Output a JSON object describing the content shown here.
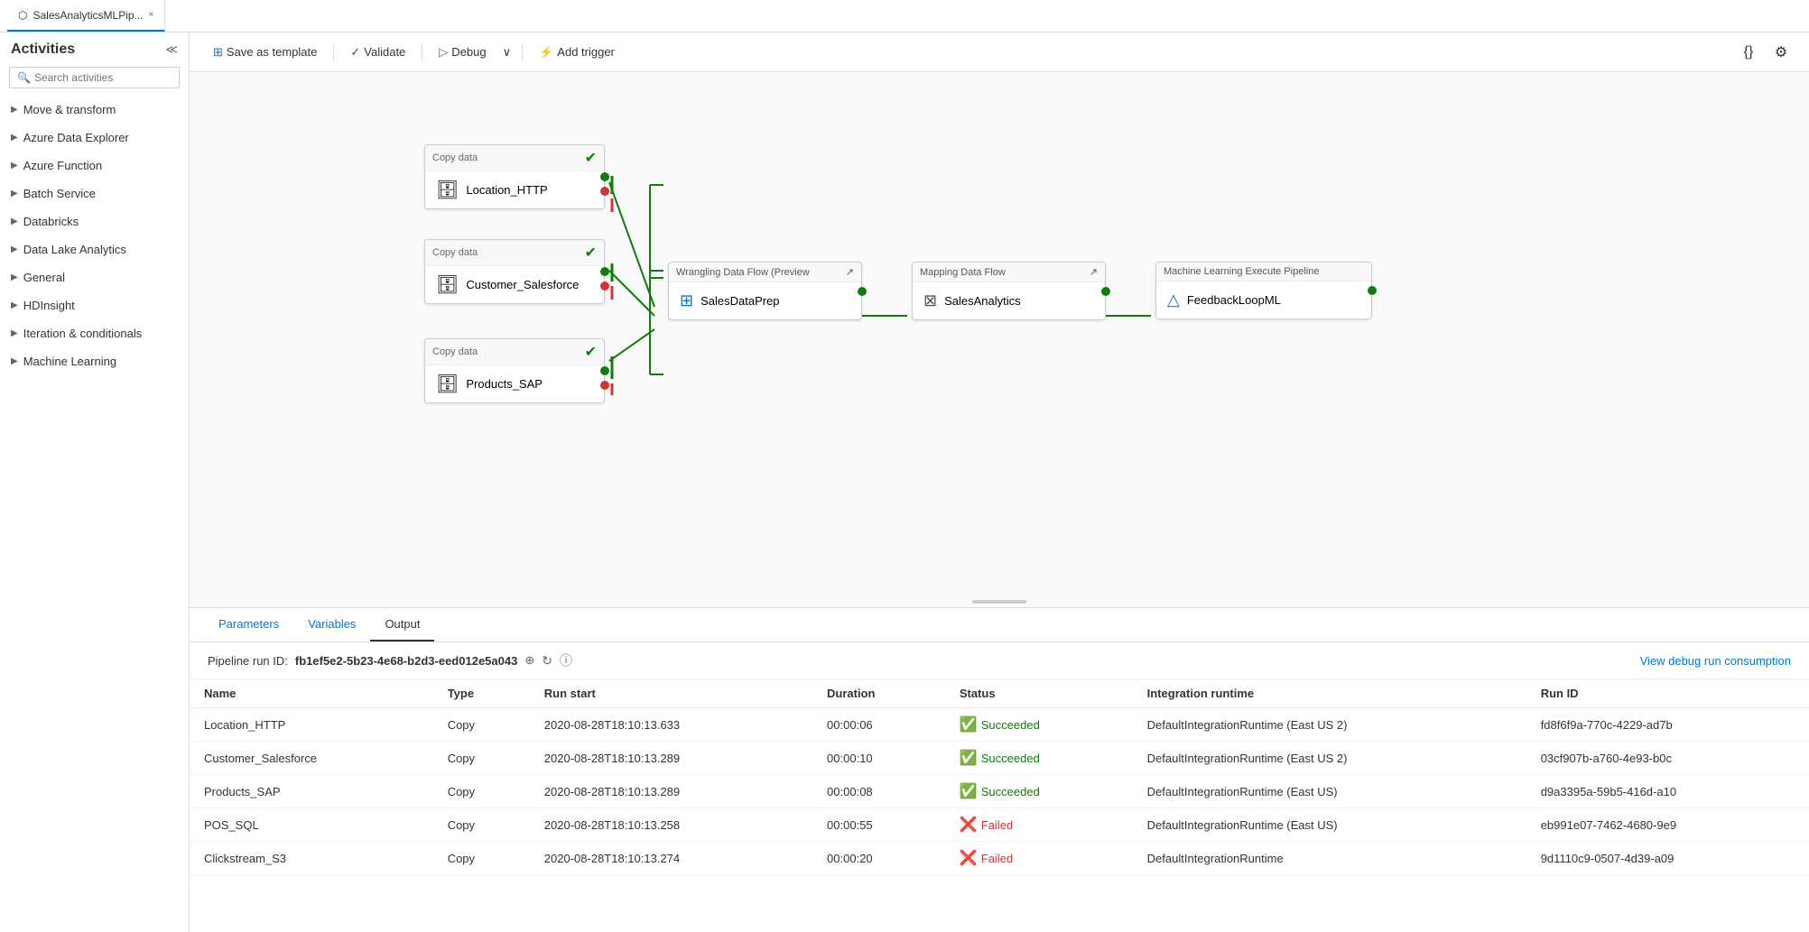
{
  "tab": {
    "title": "SalesAnalyticsMLPip...",
    "close_label": "×"
  },
  "toolbar": {
    "save_template_label": "Save as template",
    "validate_label": "Validate",
    "debug_label": "Debug",
    "add_trigger_label": "Add trigger"
  },
  "sidebar": {
    "title": "Activities",
    "search_placeholder": "Search activities",
    "items": [
      {
        "label": "Move & transform"
      },
      {
        "label": "Azure Data Explorer"
      },
      {
        "label": "Azure Function"
      },
      {
        "label": "Batch Service"
      },
      {
        "label": "Databricks"
      },
      {
        "label": "Data Lake Analytics"
      },
      {
        "label": "General"
      },
      {
        "label": "HDInsight"
      },
      {
        "label": "Iteration & conditionals"
      },
      {
        "label": "Machine Learning"
      }
    ]
  },
  "pipeline": {
    "nodes": {
      "copy1": {
        "header": "Copy data",
        "name": "Location_HTTP"
      },
      "copy2": {
        "header": "Copy data",
        "name": "Customer_Salesforce"
      },
      "copy3": {
        "header": "Copy data",
        "name": "Products_SAP"
      },
      "wrangling": {
        "header": "Wrangling Data Flow (Preview ↗",
        "name": "SalesDataPrep"
      },
      "mapping": {
        "header": "Mapping Data Flow",
        "name": "SalesAnalytics"
      },
      "ml": {
        "header": "Machine Learning Execute Pipeline",
        "name": "FeedbackLoopML"
      }
    }
  },
  "bottom_panel": {
    "tabs": [
      {
        "label": "Parameters",
        "active": false
      },
      {
        "label": "Variables",
        "active": false
      },
      {
        "label": "Output",
        "active": true
      }
    ],
    "pipeline_run_label": "Pipeline run ID:",
    "pipeline_run_id": "fb1ef5e2-5b23-4e68-b2d3-eed012e5a043",
    "view_debug_label": "View debug run consumption",
    "table": {
      "headers": [
        "Name",
        "Type",
        "Run start",
        "Duration",
        "Status",
        "Integration runtime",
        "Run ID"
      ],
      "rows": [
        {
          "name": "Location_HTTP",
          "type": "Copy",
          "run_start": "2020-08-28T18:10:13.633",
          "duration": "00:00:06",
          "status": "Succeeded",
          "status_type": "success",
          "integration_runtime": "DefaultIntegrationRuntime (East US 2)",
          "run_id": "fd8f6f9a-770c-4229-ad7b"
        },
        {
          "name": "Customer_Salesforce",
          "type": "Copy",
          "run_start": "2020-08-28T18:10:13.289",
          "duration": "00:00:10",
          "status": "Succeeded",
          "status_type": "success",
          "integration_runtime": "DefaultIntegrationRuntime (East US 2)",
          "run_id": "03cf907b-a760-4e93-b0c"
        },
        {
          "name": "Products_SAP",
          "type": "Copy",
          "run_start": "2020-08-28T18:10:13.289",
          "duration": "00:00:08",
          "status": "Succeeded",
          "status_type": "success",
          "integration_runtime": "DefaultIntegrationRuntime (East US)",
          "run_id": "d9a3395a-59b5-416d-a10"
        },
        {
          "name": "POS_SQL",
          "type": "Copy",
          "run_start": "2020-08-28T18:10:13.258",
          "duration": "00:00:55",
          "status": "Failed",
          "status_type": "failed",
          "integration_runtime": "DefaultIntegrationRuntime (East US)",
          "run_id": "eb991e07-7462-4680-9e9"
        },
        {
          "name": "Clickstream_S3",
          "type": "Copy",
          "run_start": "2020-08-28T18:10:13.274",
          "duration": "00:00:20",
          "status": "Failed",
          "status_type": "failed",
          "integration_runtime": "DefaultIntegrationRuntime",
          "run_id": "9d1110c9-0507-4d39-a09"
        }
      ]
    }
  }
}
